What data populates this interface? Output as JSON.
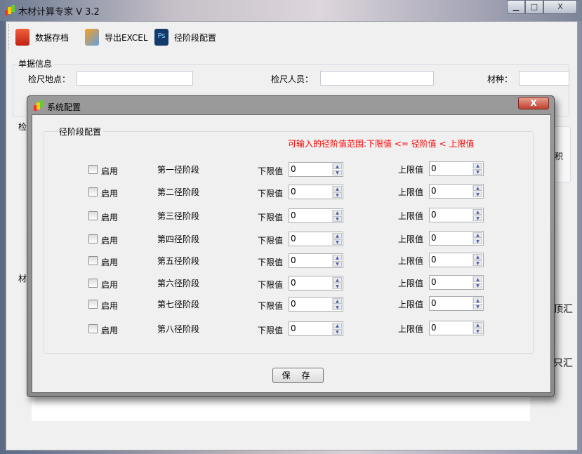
{
  "window": {
    "title": "木材计算专家 V 3.2",
    "minimize": "▁",
    "maximize": "□",
    "close": "X"
  },
  "toolbar": [
    {
      "label": "数据存档",
      "icon": "archive-icon"
    },
    {
      "label": "导出EXCEL",
      "icon": "excel-icon"
    },
    {
      "label": "径阶段配置",
      "icon": "ps-icon"
    }
  ],
  "doc_info": {
    "title": "单据信息",
    "site_label": "检尺地点：",
    "inspector_label": "检尺人员：",
    "species_label": "材种："
  },
  "background_fragments": {
    "group2": "检",
    "group3": "材",
    "col_header": "积",
    "summary1": "顶汇",
    "summary2": "只汇"
  },
  "dialog": {
    "title": "系统配置",
    "close": "X",
    "group_title": "径阶段配置",
    "hint": "可输入的径阶值范围:下限值 <= 径阶值 < 上限值",
    "enable_label": "启用",
    "lower_label": "下限值",
    "upper_label": "上限值",
    "save": "保 存",
    "rows": [
      {
        "name": "第一径阶段",
        "lower": "0",
        "upper": "0",
        "enabled": false
      },
      {
        "name": "第二径阶段",
        "lower": "0",
        "upper": "0",
        "enabled": false
      },
      {
        "name": "第三径阶段",
        "lower": "0",
        "upper": "0",
        "enabled": false
      },
      {
        "name": "第四径阶段",
        "lower": "0",
        "upper": "0",
        "enabled": false
      },
      {
        "name": "第五径阶段",
        "lower": "0",
        "upper": "0",
        "enabled": false
      },
      {
        "name": "第六径阶段",
        "lower": "0",
        "upper": "0",
        "enabled": false
      },
      {
        "name": "第七径阶段",
        "lower": "0",
        "upper": "0",
        "enabled": false
      },
      {
        "name": "第八径阶段",
        "lower": "0",
        "upper": "0",
        "enabled": false
      }
    ]
  },
  "colors": {
    "hint": "#ff0000"
  }
}
